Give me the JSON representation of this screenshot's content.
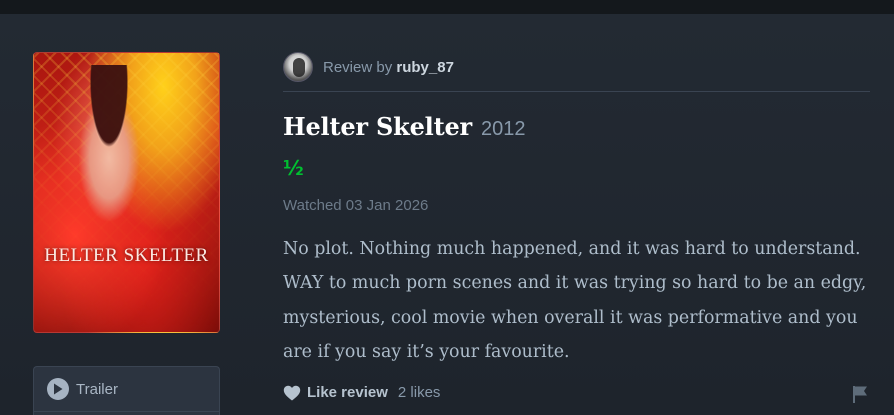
{
  "poster": {
    "title": "HELTER SKELTER"
  },
  "sidebar": {
    "trailer_label": "Trailer",
    "play_icon": "play-icon"
  },
  "review": {
    "by_prefix": "Review by",
    "username": "ruby_87",
    "film_title": "Helter Skelter",
    "year": "2012",
    "rating": "½",
    "rating_value": 0.5,
    "watched": "Watched 03 Jan 2026",
    "text": "No plot. Nothing much happened, and it was hard to understand. WAY to much porn scenes and it was trying so hard to be an edgy, mysterious, cool movie when overall it was performative and you are if you say it’s your favourite.",
    "like_label": "Like review",
    "likes_count": "2 likes"
  },
  "colors": {
    "background": "#1f252d",
    "rating_green": "#00c030",
    "title_white": "#ffffff",
    "muted": "#8899aa"
  },
  "icons": [
    "avatar",
    "play-icon",
    "heart-icon",
    "flag-icon"
  ]
}
